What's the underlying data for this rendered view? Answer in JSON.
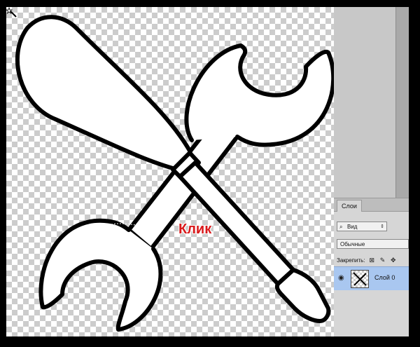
{
  "canvas": {
    "annotation_label": "Клик",
    "annotation_color": "#d9191b",
    "tool_icon": "magic-wand-icon"
  },
  "layers_panel": {
    "tab_label": "Слои",
    "filter_icon": "search-icon",
    "filter_value": "Вид",
    "blend_mode": "Обычные",
    "lock_label": "Закрепить:",
    "lock_icons": [
      "lock-transparency-icon",
      "lock-pixels-icon",
      "lock-position-icon",
      "lock-all-icon"
    ],
    "layer": {
      "visibility_icon": "eye-icon",
      "name": "Слой 0",
      "selected_color": "#a9c7f0"
    }
  }
}
